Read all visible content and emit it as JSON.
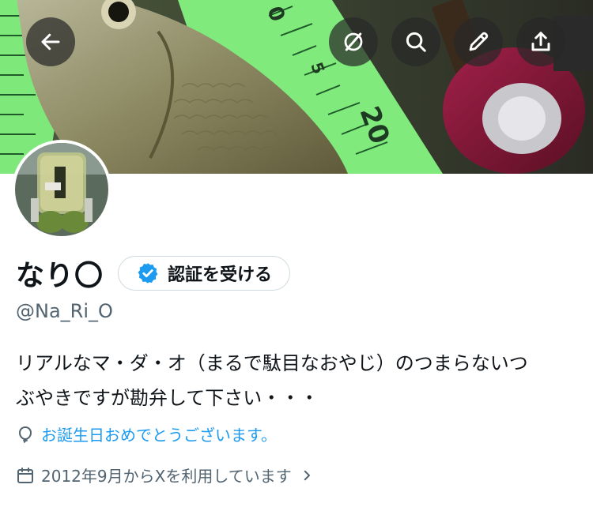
{
  "banner": {
    "ruler_marks": [
      "0",
      "5",
      "20"
    ]
  },
  "header_actions": [
    {
      "icon": "arrow-left-icon",
      "name": "back-button"
    },
    {
      "icon": "lightning-slash-icon",
      "name": "grok-button"
    },
    {
      "icon": "search-icon",
      "name": "search-button"
    },
    {
      "icon": "pencil-icon",
      "name": "edit-button"
    },
    {
      "icon": "share-icon",
      "name": "share-button"
    }
  ],
  "profile": {
    "display_name": "なり〇",
    "verify_label": "認証を受ける",
    "handle": "@Na_Ri_O",
    "bio_line1": "リアルなマ・ダ・オ（まるで駄目なおやじ）のつまらないつ",
    "bio_line2": "ぶやきですが勘弁して下さい・・・",
    "birthday_text": "お誕生日おめでとうございます。",
    "joined_text": "2012年9月からXを利用しています"
  },
  "colors": {
    "accent": "#1d9bf0",
    "secondary_text": "#536471",
    "primary_text": "#0f1419",
    "ruler_green": "#7fe87a"
  }
}
